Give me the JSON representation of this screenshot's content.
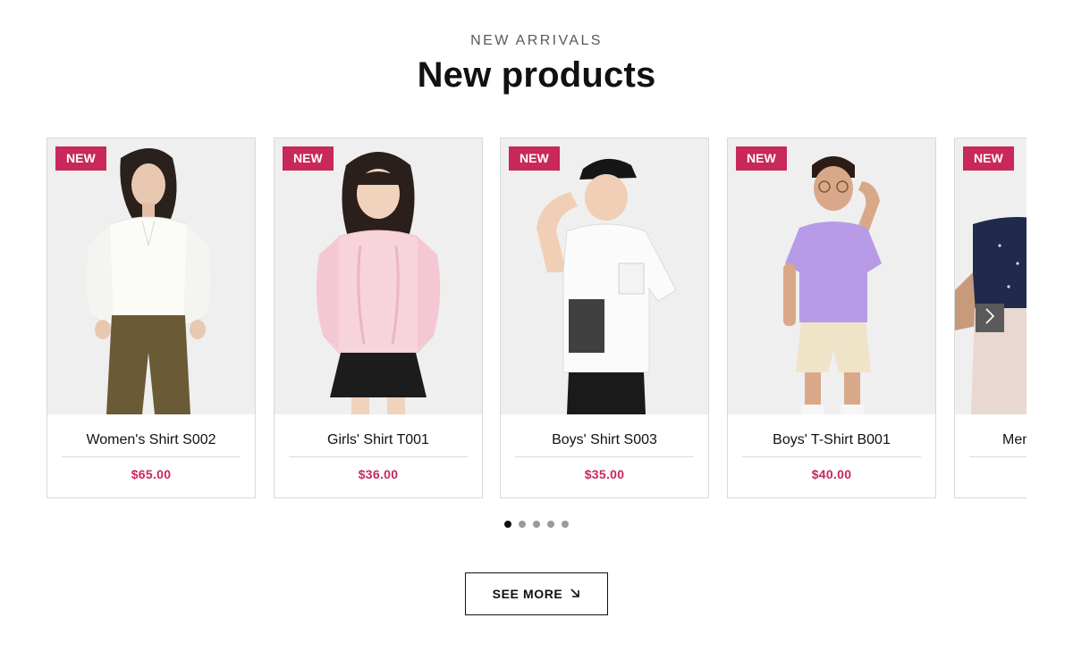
{
  "section": {
    "eyebrow": "NEW ARRIVALS",
    "title": "New products"
  },
  "products": [
    {
      "badge": "NEW",
      "name": "Women's Shirt S002",
      "price": "$65.00"
    },
    {
      "badge": "NEW",
      "name": "Girls' Shirt T001",
      "price": "$36.00"
    },
    {
      "badge": "NEW",
      "name": "Boys' Shirt S003",
      "price": "$35.00"
    },
    {
      "badge": "NEW",
      "name": "Boys' T-Shirt B001",
      "price": "$40.00"
    },
    {
      "badge": "NEW",
      "name": "Men",
      "price": ""
    }
  ],
  "carousel": {
    "next_icon": "chevron-right-icon",
    "pages": 5,
    "active_page": 1
  },
  "cta": {
    "label": "SEE MORE",
    "icon": "arrow-down-right-icon"
  },
  "colors": {
    "accent": "#c8285a",
    "text": "#111111",
    "muted": "#5a5a5a",
    "border": "#d9d9d9"
  }
}
